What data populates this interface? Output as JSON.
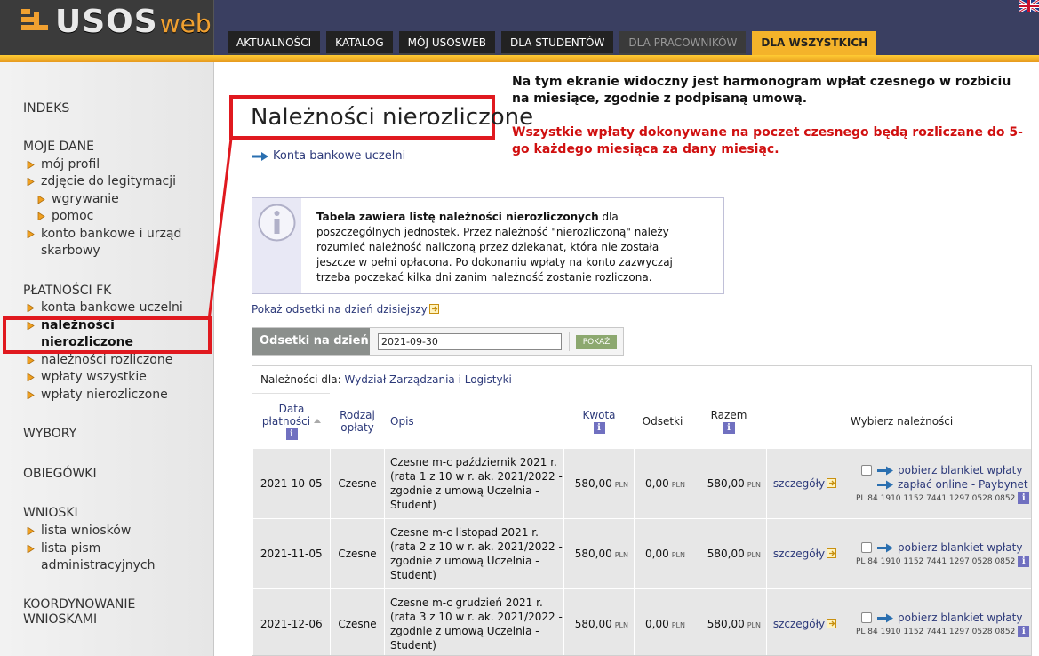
{
  "header": {
    "logo_main": "USOS",
    "logo_suffix": "web",
    "tabs": [
      {
        "label": "AKTUALNOŚCI",
        "state": "normal"
      },
      {
        "label": "KATALOG",
        "state": "normal"
      },
      {
        "label": "MÓJ USOSWEB",
        "state": "normal"
      },
      {
        "label": "DLA STUDENTÓW",
        "state": "normal"
      },
      {
        "label": "DLA PRACOWNIKÓW",
        "state": "dim"
      },
      {
        "label": "DLA WSZYSTKICH",
        "state": "active"
      }
    ],
    "language_icon": "uk-flag-icon"
  },
  "sidebar": {
    "sections": {
      "indeks": "INDEKS",
      "moje_dane": "MOJE DANE",
      "platnosci": "PŁATNOŚCI FK",
      "wybory": "WYBORY",
      "obiegowki": "OBIEGÓWKI",
      "wnioski": "WNIOSKI",
      "koordynowanie_1": "KOORDYNOWANIE",
      "koordynowanie_2": "WNIOSKAMI"
    },
    "moje_dane_items": {
      "profil": "mój profil",
      "zdjecie": "zdjęcie do legitymacji",
      "wgrywanie": "wgrywanie",
      "pomoc": "pomoc",
      "konto_1": "konto bankowe i urząd",
      "konto_2": "skarbowy"
    },
    "platnosci_items": {
      "konta": "konta bankowe uczelni",
      "nalez_nierozl_1": "należności",
      "nalez_nierozl_2": "nierozliczone",
      "nalez_rozl": "należności rozliczone",
      "wplaty_wszystkie": "wpłaty wszystkie",
      "wplaty_nierozl": "wpłaty nierozliczone"
    },
    "wnioski_items": {
      "lista_wnioskow": "lista wniosków",
      "lista_pism_1": "lista pism",
      "lista_pism_2": "administracyjnych"
    }
  },
  "main": {
    "title": "Należności nierozliczone",
    "accounts_link": "Konta bankowe uczelni",
    "notice": {
      "line1": "Na tym ekranie widoczny jest harmonogram wpłat czesnego w rozbiciu na miesiące, zgodnie z podpisaną umową.",
      "line2": "Wszystkie wpłaty dokonywane na poczet czesnego będą rozliczane do 5-go każdego miesiąca za dany miesiąc."
    },
    "info": {
      "bold": "Tabela zawiera listę należności nierozliczonych",
      "rest": " dla poszczególnych jednostek. Przez należność \"nierozliczoną\" należy rozumieć należność naliczoną przez dziekanat, która nie została jeszcze w pełni opłacona. Po dokonaniu wpłaty na konto zazwyczaj trzeba poczekać kilka dni zanim należność zostanie rozliczona."
    },
    "interest_link": "Pokaż odsetki na dzień dzisiejszy",
    "date_form": {
      "label": "Odsetki na dzień",
      "value": "2021-09-30",
      "button": "POKAŻ"
    },
    "table": {
      "for_label": "Należności dla:",
      "unit": "Wydział Zarządzania i Logistyki",
      "headers": {
        "date_1": "Data",
        "date_2": "płatności",
        "type_1": "Rodzaj",
        "type_2": "opłaty",
        "desc": "Opis",
        "amount": "Kwota",
        "interest": "Odsetki",
        "total": "Razem",
        "select": "Wybierz należności"
      },
      "currency": "PLN",
      "details_label": "szczegóły",
      "download_label": "pobierz blankiet wpłaty",
      "pay_online_label": "zapłać online - Paybynet",
      "rows": [
        {
          "date": "2021-10-05",
          "type": "Czesne",
          "desc": "Czesne m-c październik 2021 r. (rata 1 z 10 w r. ak. 2021/2022 - zgodnie z umową Uczelnia - Student)",
          "amount": "580,00",
          "interest": "0,00",
          "total": "580,00",
          "account": "PL 84 1910 1152 7441 1297 0528 0852",
          "pay_online": true
        },
        {
          "date": "2021-11-05",
          "type": "Czesne",
          "desc": "Czesne m-c listopad 2021 r. (rata 2 z 10 w r. ak. 2021/2022 - zgodnie z umową Uczelnia - Student)",
          "amount": "580,00",
          "interest": "0,00",
          "total": "580,00",
          "account": "PL 84 1910 1152 7441 1297 0528 0852",
          "pay_online": false
        },
        {
          "date": "2021-12-06",
          "type": "Czesne",
          "desc": "Czesne m-c grudzień 2021 r. (rata 3 z 10 w r. ak. 2021/2022 - zgodnie z umową Uczelnia - Student)",
          "amount": "580,00",
          "interest": "0,00",
          "total": "580,00",
          "account": "PL 84 1910 1152 7441 1297 0528 0852",
          "pay_online": false
        }
      ]
    }
  }
}
